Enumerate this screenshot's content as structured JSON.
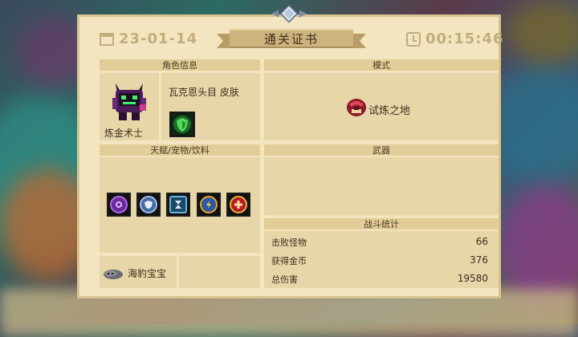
{
  "header": {
    "date": "23-01-14",
    "title": "通关证书",
    "time": "00:15:46"
  },
  "character": {
    "section_label": "角色信息",
    "name": "炼金术士",
    "skin": "瓦克恩头目  皮肤"
  },
  "mode": {
    "section_label": "模式",
    "value": "试炼之地"
  },
  "talents": {
    "section_label": "天赋/宠物/饮料",
    "icons": [
      "poison-talent-icon",
      "shield-talent-icon",
      "hourglass-talent-icon",
      "crit-talent-icon",
      "heal-talent-icon"
    ],
    "pet": "海豹宝宝"
  },
  "weapons": {
    "section_label": "武器"
  },
  "stats": {
    "section_label": "战斗统计",
    "rows": [
      {
        "label": "击败怪物",
        "value": "66"
      },
      {
        "label": "获得金币",
        "value": "376"
      },
      {
        "label": "总伤害",
        "value": "19580"
      }
    ]
  },
  "colors": {
    "panel": "#f2e5bf",
    "section": "#e7d6a8",
    "header_text": "#c2ad7b"
  }
}
